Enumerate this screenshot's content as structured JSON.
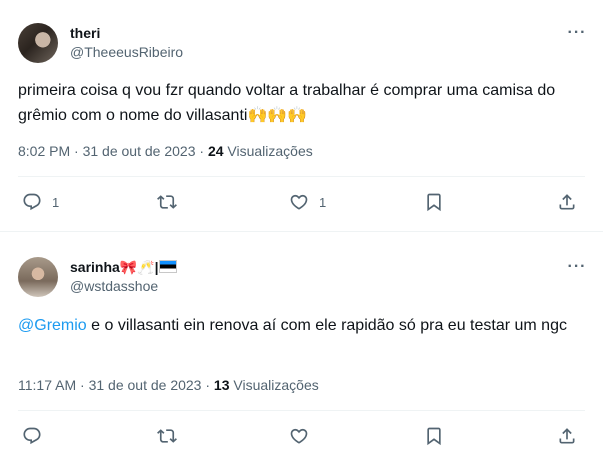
{
  "tweets": [
    {
      "name": "theri",
      "handle": "@TheeeusRibeiro",
      "text": "primeira coisa q vou fzr quando voltar a trabalhar é comprar uma camisa do grêmio com o nome do villasanti🙌🙌🙌",
      "time": "8:02 PM",
      "sep": "·",
      "date": "31 de out de 2023",
      "views_count": "24",
      "views_label": "Visualizações",
      "reply_count": "1",
      "retweet_count": "",
      "like_count": "1"
    },
    {
      "name": "sarinha🎀🥂|",
      "handle": "@wstdasshoe",
      "mention": "@Gremio",
      "text": " e o villasanti ein renova aí com ele rapidão só pra eu testar um ngc",
      "time": "11:17 AM",
      "sep": "·",
      "date": "31 de out de 2023",
      "views_count": "13",
      "views_label": "Visualizações",
      "reply_count": "",
      "retweet_count": "",
      "like_count": ""
    }
  ],
  "icons": {
    "reply": "reply-icon",
    "retweet": "retweet-icon",
    "like": "heart-icon",
    "bookmark": "bookmark-icon",
    "share": "share-icon",
    "more": "more-icon"
  },
  "colors": {
    "text": "#0f1419",
    "secondary": "#536471",
    "mention": "#1d9bf0",
    "divider": "#eff3f4"
  }
}
